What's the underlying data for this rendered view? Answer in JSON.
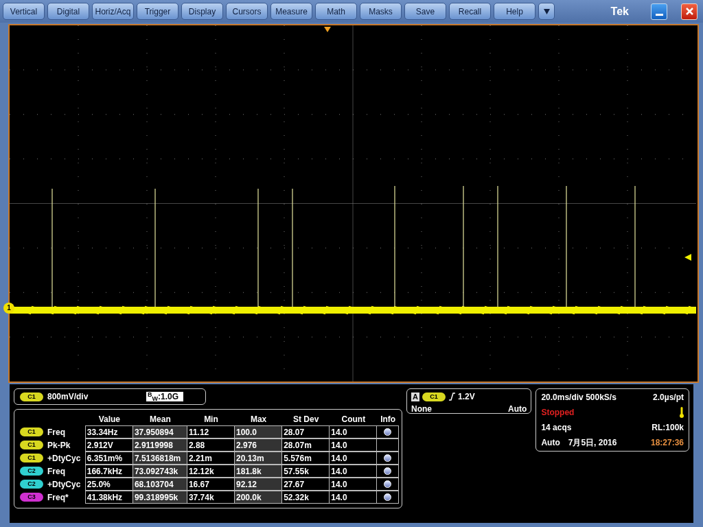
{
  "menu": {
    "items": [
      "Vertical",
      "Digital",
      "Horiz/Acq",
      "Trigger",
      "Display",
      "Cursors",
      "Measure",
      "Math",
      "Masks",
      "Save",
      "Recall",
      "Help"
    ]
  },
  "brand": "Tek",
  "display": {
    "channel_marker": "1"
  },
  "channel_readout": {
    "badge": "C1",
    "color": "#d8d820",
    "scale": "800mV/div",
    "bandwidth": "$^{B}$$_{W}$:1.0G"
  },
  "measurements": {
    "columns": [
      "Value",
      "Mean",
      "Min",
      "Max",
      "St Dev",
      "Count",
      "Info"
    ],
    "rows": [
      {
        "source": "C1",
        "color": "#d8d820",
        "name": "Freq",
        "value": "33.34Hz",
        "mean": "37.950894",
        "min": "11.12",
        "max": "100.0",
        "stdev": "28.07",
        "count": "14.0",
        "info": true
      },
      {
        "source": "C1",
        "color": "#d8d820",
        "name": "Pk-Pk",
        "value": "2.912V",
        "mean": "2.9119998",
        "min": "2.88",
        "max": "2.976",
        "stdev": "28.07m",
        "count": "14.0",
        "info": false
      },
      {
        "source": "C1",
        "color": "#d8d820",
        "name": "+DtyCyc",
        "value": "6.351m%",
        "mean": "7.5136818m",
        "min": "2.21m",
        "max": "20.13m",
        "stdev": "5.576m",
        "count": "14.0",
        "info": true
      },
      {
        "source": "C2",
        "color": "#30d0d0",
        "name": "Freq",
        "value": "166.7kHz",
        "mean": "73.092743k",
        "min": "12.12k",
        "max": "181.8k",
        "stdev": "57.55k",
        "count": "14.0",
        "info": true
      },
      {
        "source": "C2",
        "color": "#30d0d0",
        "name": "+DtyCyc",
        "value": "25.0%",
        "mean": "68.103704",
        "min": "16.67",
        "max": "92.12",
        "stdev": "27.67",
        "count": "14.0",
        "info": true
      },
      {
        "source": "C3",
        "color": "#d030d0",
        "name": "Freq*",
        "value": "41.38kHz",
        "mean": "99.318995k",
        "min": "37.74k",
        "max": "200.0k",
        "stdev": "52.32k",
        "count": "14.0",
        "info": true
      }
    ]
  },
  "trigger": {
    "type": "A",
    "badge": "C1",
    "color": "#d8d820",
    "level": "1.2V",
    "coupling": "None",
    "mode": "Auto"
  },
  "acquisition": {
    "timebase": "20.0ms/div",
    "sample_rate": "500kS/s",
    "resolution": "2.0µs/pt",
    "status": "Stopped",
    "acqs": "14 acqs",
    "record_length": "RL:100k",
    "mode": "Auto",
    "date": "7月5日, 2016",
    "time": "18:27:36"
  }
}
